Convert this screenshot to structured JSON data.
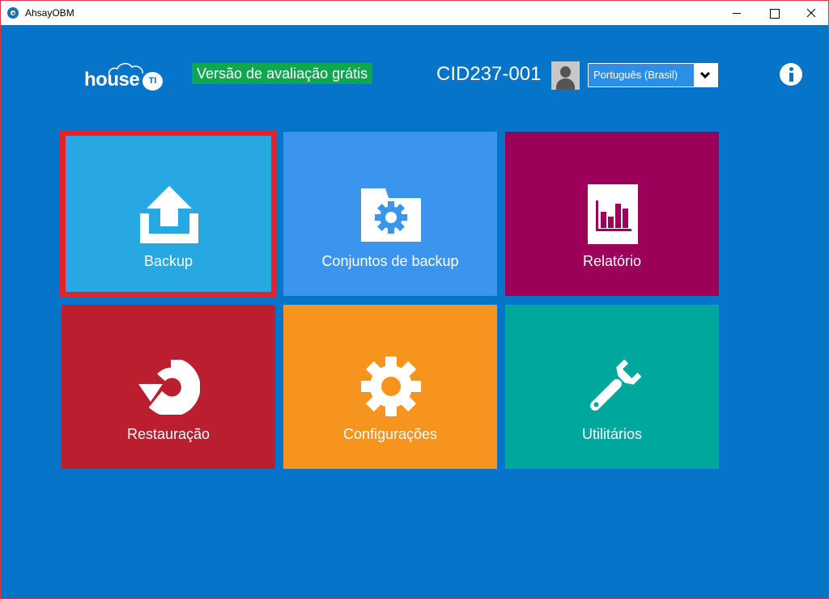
{
  "window": {
    "title": "AhsayOBM",
    "controls": [
      "minimize",
      "maximize",
      "close"
    ]
  },
  "header": {
    "logo_text": "house",
    "logo_badge": "TI",
    "trial_badge": "Versão de avaliação grátis",
    "user_id": "CID237-001",
    "language": {
      "selected": "Português (Brasil)"
    },
    "info_icon": "info-icon"
  },
  "tiles": [
    {
      "label": "Backup",
      "icon": "upload-icon",
      "color": "#27a8e2",
      "selected": true
    },
    {
      "label": "Conjuntos de backup",
      "icon": "folder-gear-icon",
      "color": "#3b95ef"
    },
    {
      "label": "Relatório",
      "icon": "bar-chart-icon",
      "color": "#9c0058"
    },
    {
      "label": "Restauração",
      "icon": "restore-arrow-icon",
      "color": "#bb1e2e"
    },
    {
      "label": "Configurações",
      "icon": "gear-icon",
      "color": "#f7941e"
    },
    {
      "label": "Utilitários",
      "icon": "wrench-icon",
      "color": "#00a79d"
    }
  ],
  "colors": {
    "background": "#0574c9",
    "selection_border": "#e8202a",
    "trial_badge_bg": "#0ea64f"
  }
}
